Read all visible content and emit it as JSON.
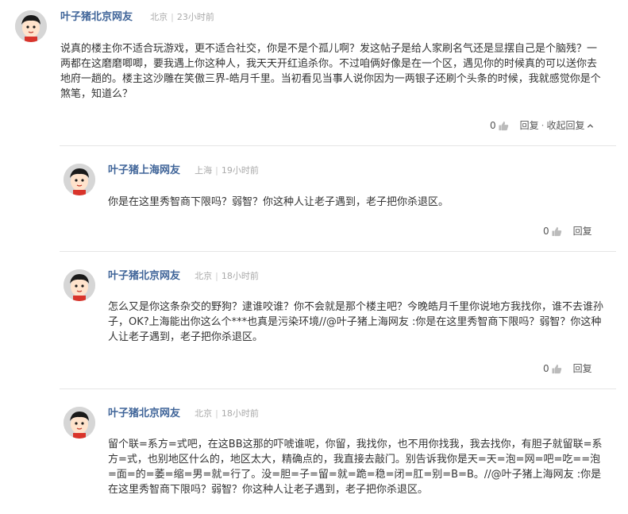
{
  "comments": [
    {
      "username": "叶子猪北京网友",
      "location": "北京",
      "time": "23小时前",
      "text": "说真的楼主你不适合玩游戏，更不适合社交，你是不是个孤儿啊？发这帖子是给人家刷名气还是显摆自己是个脑残？一两都在这磨磨唧唧，要我遇上你这种人，我天天开红追杀你。不过咱俩好像是在一个区，遇见你的时候真的可以送你去地府一趟的。楼主这沙雕在笑傲三界-皓月千里。当初看见当事人说你因为一两银子还刷个头条的时候，我就感觉你是个煞笔，知道么？",
      "likes": "0",
      "reply_label": "回复",
      "collapse_label": "收起回复"
    }
  ],
  "replies": [
    {
      "username": "叶子猪上海网友",
      "location": "上海",
      "time": "19小时前",
      "text": "你是在这里秀智商下限吗？弱智？你这种人让老子遇到，老子把你杀退区。",
      "likes": "0",
      "reply_label": "回复"
    },
    {
      "username": "叶子猪北京网友",
      "location": "北京",
      "time": "18小时前",
      "text": "怎么又是你这条杂交的野狗？逮谁咬谁？你不会就是那个楼主吧？今晚皓月千里你说地方我找你，谁不去谁孙子，OK?上海能出你这么个***也真是污染环境//@叶子猪上海网友 :你是在这里秀智商下限吗？弱智？你这种人让老子遇到，老子把你杀退区。",
      "likes": "0",
      "reply_label": "回复"
    },
    {
      "username": "叶子猪北京网友",
      "location": "北京",
      "time": "18小时前",
      "text": "留个联=系方=式吧，在这BB这那的吓唬谁呢，你留，我找你，也不用你找我，我去找你，有胆子就留联=系方=式，也别地区什么的，地区太大，精确点的，我直接去敲门。别告诉我你是天=天=泡=网=吧=吃==泡=面=的=萎=缩=男=就=行了。没=胆=子=留=就=跪=稳=闭=肛=别=B=B。//@叶子猪上海网友 :你是在这里秀智商下限吗？弱智？你这种人让老子遇到，老子把你杀退区。"
    }
  ],
  "icons": {
    "avatar": "cartoon-avatar-icon",
    "thumb": "thumbs-up-icon",
    "chevron": "chevron-up-icon"
  },
  "colors": {
    "username": "#406599",
    "meta": "#aaaaaa",
    "divider": "#e5e5e5"
  }
}
